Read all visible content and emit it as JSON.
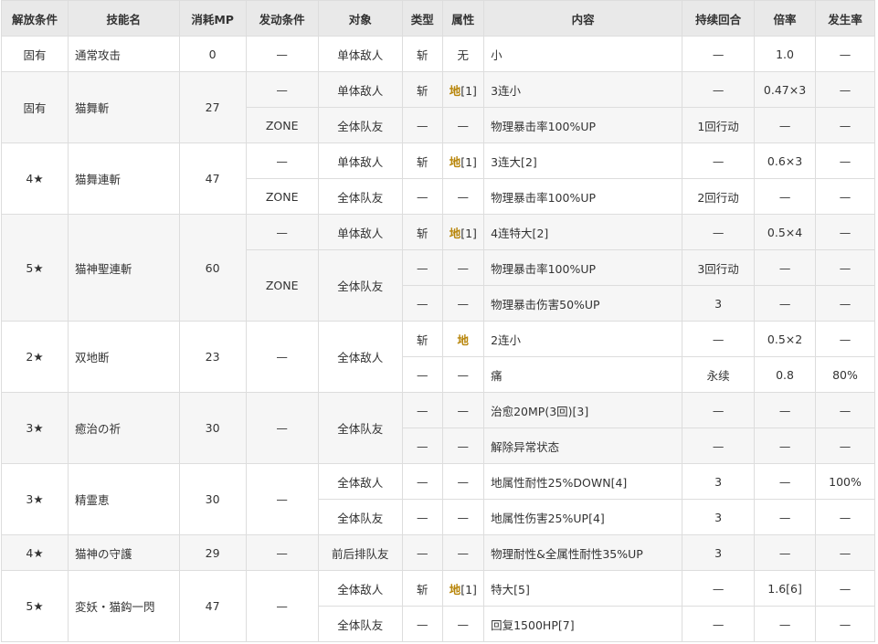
{
  "headers": [
    "解放条件",
    "技能名",
    "消耗MP",
    "发动条件",
    "对象",
    "类型",
    "属性",
    "内容",
    "持续回合",
    "倍率",
    "发生率"
  ],
  "skills": [
    {
      "unlock": "固有",
      "name": "通常攻击",
      "mp": "0",
      "rows": [
        {
          "trigger": "—",
          "target": "单体敌人",
          "type": "斩",
          "attr": "无",
          "attr_ref": "",
          "content": "小",
          "duration": "—",
          "rate": "1.0",
          "chance": "—"
        }
      ]
    },
    {
      "unlock": "固有",
      "name": "猫舞斬",
      "mp": "27",
      "rows": [
        {
          "trigger": "—",
          "target": "单体敌人",
          "type": "斩",
          "attr": "地",
          "attr_ref": "[1]",
          "content": "3连小",
          "duration": "—",
          "rate": "0.47×3",
          "chance": "—"
        },
        {
          "trigger": "ZONE",
          "target": "全体队友",
          "type": "—",
          "attr": "—",
          "attr_ref": "",
          "content": "物理暴击率100%UP",
          "duration": "1回行动",
          "rate": "—",
          "chance": "—"
        }
      ]
    },
    {
      "unlock": "4★",
      "name": "猫舞連斬",
      "mp": "47",
      "rows": [
        {
          "trigger": "—",
          "target": "单体敌人",
          "type": "斩",
          "attr": "地",
          "attr_ref": "[1]",
          "content": "3连大[2]",
          "duration": "—",
          "rate": "0.6×3",
          "chance": "—"
        },
        {
          "trigger": "ZONE",
          "target": "全体队友",
          "type": "—",
          "attr": "—",
          "attr_ref": "",
          "content": "物理暴击率100%UP",
          "duration": "2回行动",
          "rate": "—",
          "chance": "—"
        }
      ]
    },
    {
      "unlock": "5★",
      "name": "猫神聖連斬",
      "mp": "60",
      "rows": [
        {
          "trigger": "—",
          "target": "单体敌人",
          "type": "斩",
          "attr": "地",
          "attr_ref": "[1]",
          "content": "4连特大[2]",
          "duration": "—",
          "rate": "0.5×4",
          "chance": "—"
        },
        {
          "trigger": "ZONE",
          "target": "全体队友",
          "type": "—",
          "attr": "—",
          "attr_ref": "",
          "content": "物理暴击率100%UP",
          "duration": "3回行动",
          "rate": "—",
          "chance": "—"
        },
        {
          "type": "—",
          "attr": "—",
          "attr_ref": "",
          "content": "物理暴击伤害50%UP",
          "duration": "3",
          "rate": "—",
          "chance": "—"
        }
      ]
    },
    {
      "unlock": "2★",
      "name": "双地断",
      "mp": "23",
      "trigger": "—",
      "target": "全体敌人",
      "rows": [
        {
          "type": "斩",
          "attr": "地",
          "attr_ref": "",
          "content": "2连小",
          "duration": "—",
          "rate": "0.5×2",
          "chance": "—"
        },
        {
          "type": "—",
          "attr": "—",
          "attr_ref": "",
          "content": "痛",
          "duration": "永续",
          "rate": "0.8",
          "chance": "80%"
        }
      ]
    },
    {
      "unlock": "3★",
      "name": "癒治の祈",
      "mp": "30",
      "trigger": "—",
      "target": "全体队友",
      "rows": [
        {
          "type": "—",
          "attr": "—",
          "attr_ref": "",
          "content": "治愈20MP(3回)[3]",
          "duration": "—",
          "rate": "—",
          "chance": "—"
        },
        {
          "type": "—",
          "attr": "—",
          "attr_ref": "",
          "content": "解除异常状态",
          "duration": "—",
          "rate": "—",
          "chance": "—"
        }
      ]
    },
    {
      "unlock": "3★",
      "name": "精霊恵",
      "mp": "30",
      "trigger": "—",
      "rows": [
        {
          "target": "全体敌人",
          "type": "—",
          "attr": "—",
          "attr_ref": "",
          "content": "地属性耐性25%DOWN[4]",
          "duration": "3",
          "rate": "—",
          "chance": "100%"
        },
        {
          "target": "全体队友",
          "type": "—",
          "attr": "—",
          "attr_ref": "",
          "content": "地属性伤害25%UP[4]",
          "duration": "3",
          "rate": "—",
          "chance": "—"
        }
      ]
    },
    {
      "unlock": "4★",
      "name": "猫神の守護",
      "mp": "29",
      "rows": [
        {
          "trigger": "—",
          "target": "前后排队友",
          "type": "—",
          "attr": "—",
          "attr_ref": "",
          "content": "物理耐性&全属性耐性35%UP",
          "duration": "3",
          "rate": "—",
          "chance": "—"
        }
      ]
    },
    {
      "unlock": "5★",
      "name": "変妖・猫鈎一閃",
      "mp": "47",
      "trigger": "—",
      "rows": [
        {
          "target": "全体敌人",
          "type": "斩",
          "attr": "地",
          "attr_ref": "[1]",
          "content": "特大[5]",
          "duration": "—",
          "rate": "1.6[6]",
          "chance": "—"
        },
        {
          "target": "全体队友",
          "type": "—",
          "attr": "—",
          "attr_ref": "",
          "content": "回复1500HP[7]",
          "duration": "—",
          "rate": "—",
          "chance": "—"
        }
      ]
    }
  ]
}
